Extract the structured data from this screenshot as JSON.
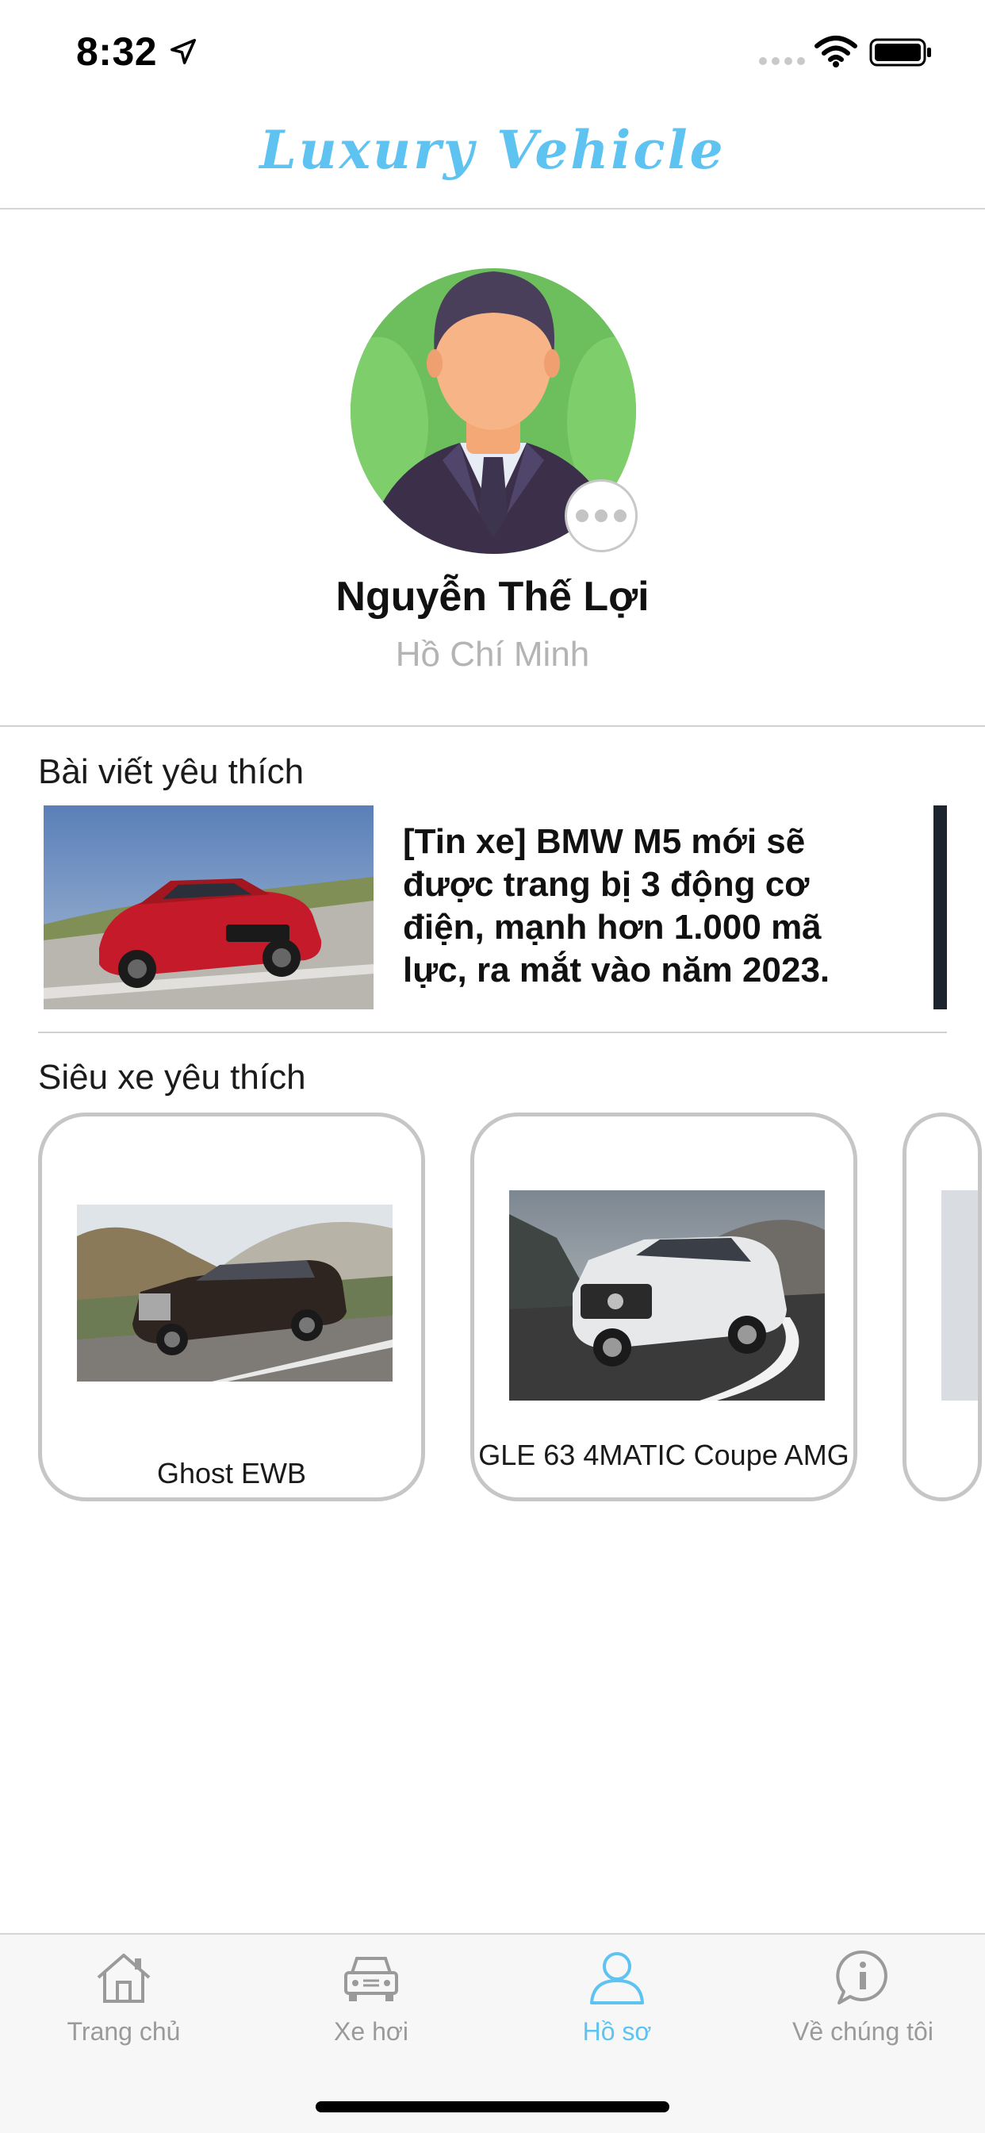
{
  "status_bar": {
    "time": "8:32"
  },
  "header": {
    "title": "Luxury Vehicle"
  },
  "profile": {
    "name": "Nguyễn Thế Lợi",
    "location": "Hồ Chí Minh"
  },
  "favorite_posts": {
    "section_title": "Bài viết yêu thích",
    "items": [
      {
        "title": "[Tin xe] BMW M5 mới sẽ được trang bị 3 động cơ điện, mạnh hơn 1.000 mã lực, ra mắt vào năm 2023."
      }
    ]
  },
  "favorite_cars": {
    "section_title": "Siêu xe yêu thích",
    "items": [
      {
        "name": "Ghost EWB"
      },
      {
        "name": "GLE 63 4MATIC Coupe AMG"
      }
    ]
  },
  "tabbar": {
    "tabs": [
      {
        "label": "Trang chủ",
        "icon": "home-icon"
      },
      {
        "label": "Xe hơi",
        "icon": "car-icon"
      },
      {
        "label": "Hồ sơ",
        "icon": "profile-icon",
        "active": true
      },
      {
        "label": "Về chúng tôi",
        "icon": "info-icon"
      }
    ]
  },
  "colors": {
    "accent": "#5ec3f0",
    "inactive": "#9a9a9a",
    "divider": "#d0d0d0"
  }
}
